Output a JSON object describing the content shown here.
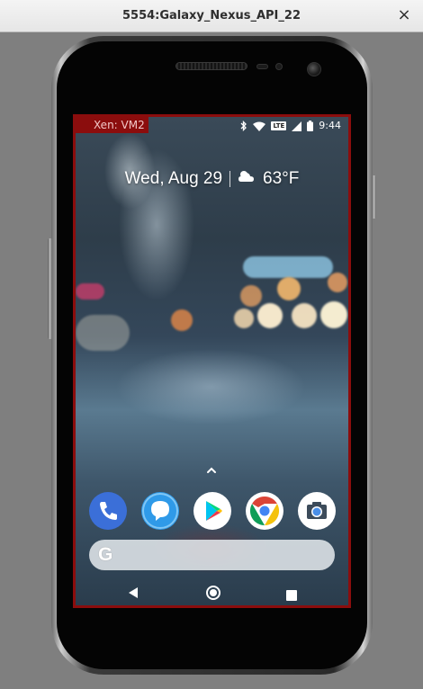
{
  "window": {
    "title": "5554:Galaxy_Nexus_API_22",
    "close_glyph": "×"
  },
  "device": {
    "vm_label": "Xen: VM2",
    "status": {
      "time": "9:44",
      "network_badge": "LTE",
      "icons": [
        "bluetooth-icon",
        "wifi-icon",
        "lte-icon",
        "cell-signal-icon",
        "battery-icon"
      ]
    },
    "glance": {
      "date": "Wed, Aug 29",
      "weather_icon": "cloud-sun-icon",
      "temperature": "63°F"
    },
    "dock": {
      "apps": [
        {
          "name": "Phone",
          "icon": "phone-icon",
          "color": "#3b6fd8"
        },
        {
          "name": "Messages",
          "icon": "messages-icon",
          "color": "#2f9ae8"
        },
        {
          "name": "Play Store",
          "icon": "play-store-icon",
          "color": "#ffffff"
        },
        {
          "name": "Chrome",
          "icon": "chrome-icon",
          "color": "#ffffff"
        },
        {
          "name": "Camera",
          "icon": "camera-icon",
          "color": "#ffffff"
        }
      ]
    },
    "search": {
      "logo": "G",
      "placeholder": ""
    },
    "navigation": [
      "back",
      "home",
      "recents"
    ]
  },
  "colors": {
    "border_accent": "#8b0d0d",
    "window_background": "#7f7f7f"
  }
}
